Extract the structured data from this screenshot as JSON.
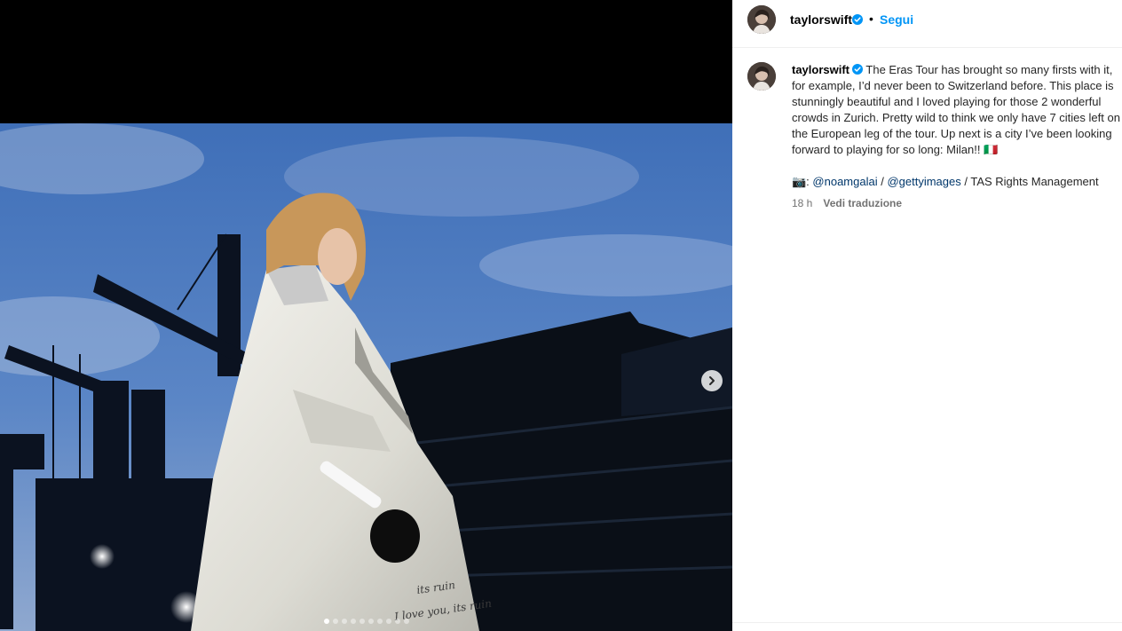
{
  "post": {
    "username": "taylorswift",
    "follow_label": "Segui",
    "separator": "•",
    "caption": "The Eras Tour has brought so many firsts with it, for example, I’d never been to Switzerland before. This place is stunningly beautiful and I loved playing for those 2 wonderful crowds in Zurich. Pretty wild to think we only have 7 cities left on the European leg of the tour. Up next is a city I’ve been looking forward to playing for so long: Milan!! 🇮🇹",
    "credits": {
      "camera": "📷: ",
      "mention_1": "@noamgalai",
      "sep_1": " / ",
      "mention_2": "@gettyimages",
      "sep_2": " / TAS Rights Management"
    },
    "time": "18 h",
    "translate_label": "Vedi traduzione"
  },
  "media": {
    "carousel_count": 10,
    "active_index": 0
  },
  "icons": {
    "verified": "verified-badge-icon",
    "next": "chevron-right-icon"
  },
  "colors": {
    "accent": "#0095f6",
    "verified": "#0095f6",
    "mention": "#00376b",
    "secondary_text": "#737373"
  }
}
